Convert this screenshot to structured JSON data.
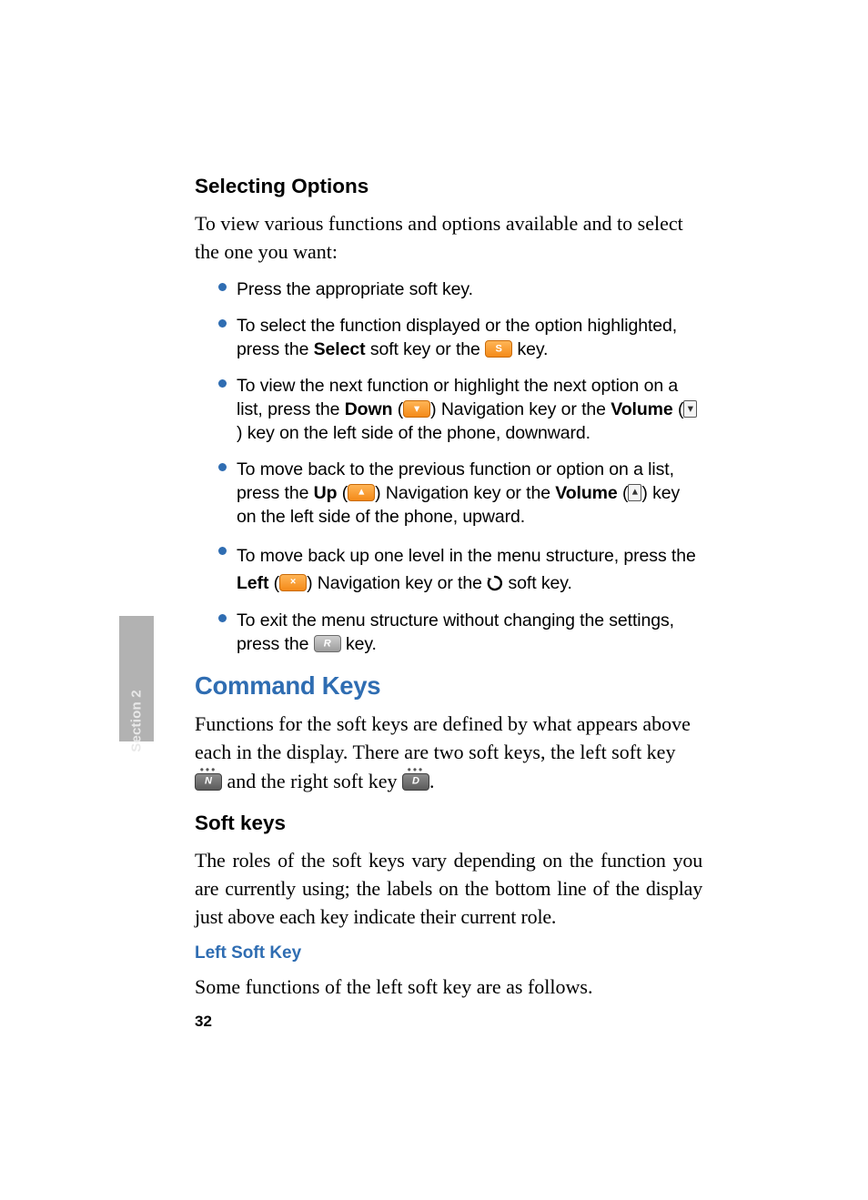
{
  "section_tab": "Section 2",
  "page_number": "32",
  "sel": {
    "heading": "Selecting Options",
    "intro": "To view various functions and options available and to select the one you want:",
    "b1": "Press the appropriate soft key.",
    "b2_a": "To select the function displayed or the option highlighted, press the ",
    "b2_select": "Select",
    "b2_b": " soft key or the ",
    "b2_c": " key.",
    "b3_a": "To view the next function or highlight the next option on a list, press the ",
    "b3_down": "Down",
    "b3_b": " (",
    "b3_c": ") Navigation key or the ",
    "b3_vol": "Volume",
    "b3_d": " (",
    "b3_e": ") key on the left side of the phone, downward.",
    "b4_a": "To move back to the previous function or option on a list, press the ",
    "b4_up": "Up",
    "b4_b": " (",
    "b4_c": ") Navigation key or the ",
    "b4_vol": "Volume",
    "b4_d": " (",
    "b4_e": ") key on the left side of the phone, upward.",
    "b5_a": "To move back up one level in the menu structure, press the ",
    "b5_left": "Left",
    "b5_b": " (",
    "b5_c": ") Navigation key or the ",
    "b5_d": " soft key.",
    "b6_a": "To exit the menu structure without changing the settings, press the ",
    "b6_b": " key."
  },
  "cmd": {
    "heading": "Command Keys",
    "p_a": "Functions for the soft keys are defined by what appears above each in the display. There are two soft keys, the left soft key ",
    "p_b": " and the right soft key ",
    "p_c": "."
  },
  "soft": {
    "heading": "Soft keys",
    "para": "The roles of the soft keys vary depending on the function you are currently using; the labels on the bottom line of the display just above each key indicate their current role."
  },
  "left_soft": {
    "heading": "Left Soft Key",
    "para": "Some functions of the left soft key are as follows."
  },
  "glyphs": {
    "s": "S",
    "down": "▾",
    "up": "▴",
    "vol_down": "▾",
    "vol_up": "▴",
    "left_x": "×",
    "exit_r": "R",
    "soft_left": "N",
    "soft_right": "D",
    "dots": "•••"
  }
}
